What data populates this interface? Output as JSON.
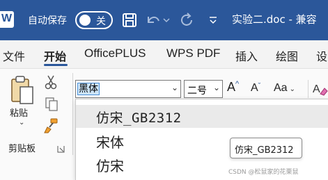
{
  "titlebar": {
    "app_icon": "word-icon",
    "app_letter": "W",
    "autosave_label": "自动保存",
    "autosave_state": "关",
    "doc_title": "实验二.doc  -  兼容",
    "bg_color": "#2b579a"
  },
  "tabs": [
    {
      "label": "文件",
      "active": false
    },
    {
      "label": "开始",
      "active": true
    },
    {
      "label": "OfficePLUS",
      "active": false
    },
    {
      "label": "WPS PDF",
      "active": false
    },
    {
      "label": "插入",
      "active": false
    },
    {
      "label": "绘图",
      "active": false
    },
    {
      "label": "设",
      "active": false
    }
  ],
  "clipboard": {
    "paste_label": "粘贴",
    "group_label": "剪贴板"
  },
  "font": {
    "current_font": "黑体",
    "current_size": "二号",
    "grow_label": "A",
    "shrink_label": "A",
    "case_label": "Aa"
  },
  "font_list": {
    "items": [
      {
        "label": "仿宋_GB2312",
        "hover": true
      },
      {
        "label": "宋体",
        "hover": false
      },
      {
        "label": "仿宋",
        "hover": false
      }
    ]
  },
  "tooltip": "仿宋_GB2312",
  "watermark": "CSDN @松鼠家的花栗鼠"
}
